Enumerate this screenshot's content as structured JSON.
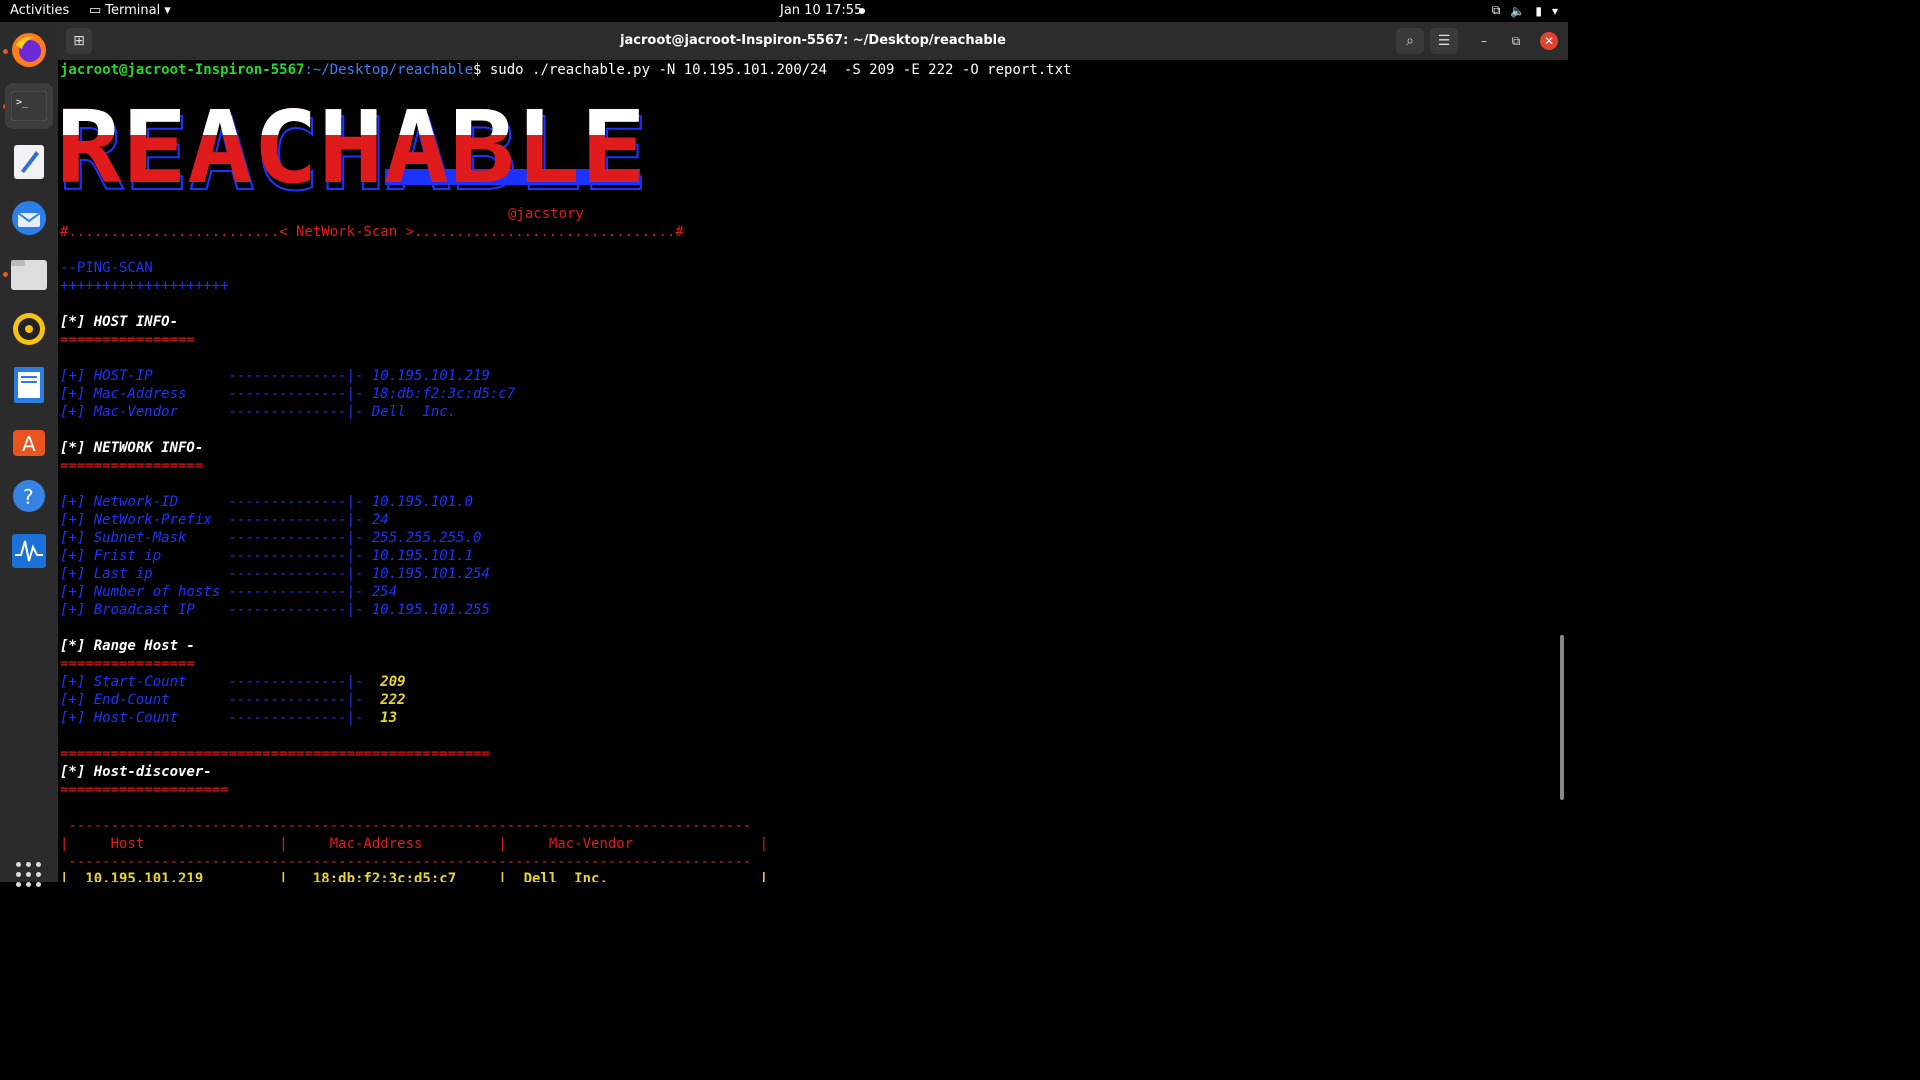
{
  "topbar": {
    "activities": "Activities",
    "app_name": "Terminal",
    "clock": "Jan 10  17:55"
  },
  "window": {
    "title": "jacroot@jacroot-Inspiron-5567: ~/Desktop/reachable"
  },
  "dock": {
    "items": [
      "firefox-icon",
      "terminal-icon",
      "text-editor-icon",
      "thunderbird-icon",
      "files-icon",
      "rhythmbox-icon",
      "writer-icon",
      "software-icon",
      "help-icon",
      "system-monitor-icon"
    ]
  },
  "terminal": {
    "prompt_user": "jacroot@jacroot-Inspiron-5567",
    "prompt_path": ":~/Desktop/reachable",
    "prompt_sym": "$",
    "command": " sudo ./reachable.py -N 10.195.101.200/24  -S 209 -E 222 -O report.txt",
    "banner_text": "REACHABLE",
    "author": "@jacstory",
    "separator": "#.........................< NetWork-Scan >...............................#",
    "ping_scan": "--PING-SCAN",
    "plus_line": "++++++++++++++++++++",
    "host_info_title": "[*] HOST INFO-",
    "eq_short": "================",
    "host_ip_label": "[+] HOST-IP         --------------|- ",
    "host_ip": "10.195.101.219",
    "mac_label": "[+] Mac-Address     --------------|- ",
    "mac": "18:db:f2:3c:d5:c7",
    "vendor_label": "[+] Mac-Vendor      --------------|- ",
    "vendor": "Dell  Inc.",
    "network_info_title": "[*] NETWORK INFO-",
    "eq_network": "=================",
    "net_id_label": "[+] Network-ID      --------------|- ",
    "net_id": "10.195.101.0",
    "prefix_label": "[+] NetWork-Prefix  --------------|- ",
    "prefix": "24",
    "mask_label": "[+] Subnet-Mask     --------------|- ",
    "mask": "255.255.255.0",
    "first_label": "[+] Frist ip        --------------|- ",
    "first": "10.195.101.1",
    "last_label": "[+] Last ip         --------------|- ",
    "last": "10.195.101.254",
    "num_label": "[+] Number of hosts --------------|- ",
    "num": "254",
    "bcast_label": "[+] Broadcast IP    --------------|- ",
    "bcast": "10.195.101.255",
    "range_title": "[*] Range Host -",
    "eq_range": "================",
    "start_label": "[+] Start-Count     --------------|-  ",
    "start": "209",
    "end_label": "[+] End-Count       --------------|-  ",
    "end": "222",
    "count_label": "[+] Host-Count      --------------|-  ",
    "count": "13",
    "eq_long": "===================================================",
    "discover_title": "[*] Host-discover-",
    "eq_discover": "====================",
    "dash_line": " ---------------------------------------------------------------------------------",
    "table_header": "|     Host                |     Mac-Address         |     Mac-Vendor               |",
    "row1_host": "|  10.195.101.219         |   18:db:f2:3c:d5:c7     |  Dell  Inc.                  |"
  }
}
